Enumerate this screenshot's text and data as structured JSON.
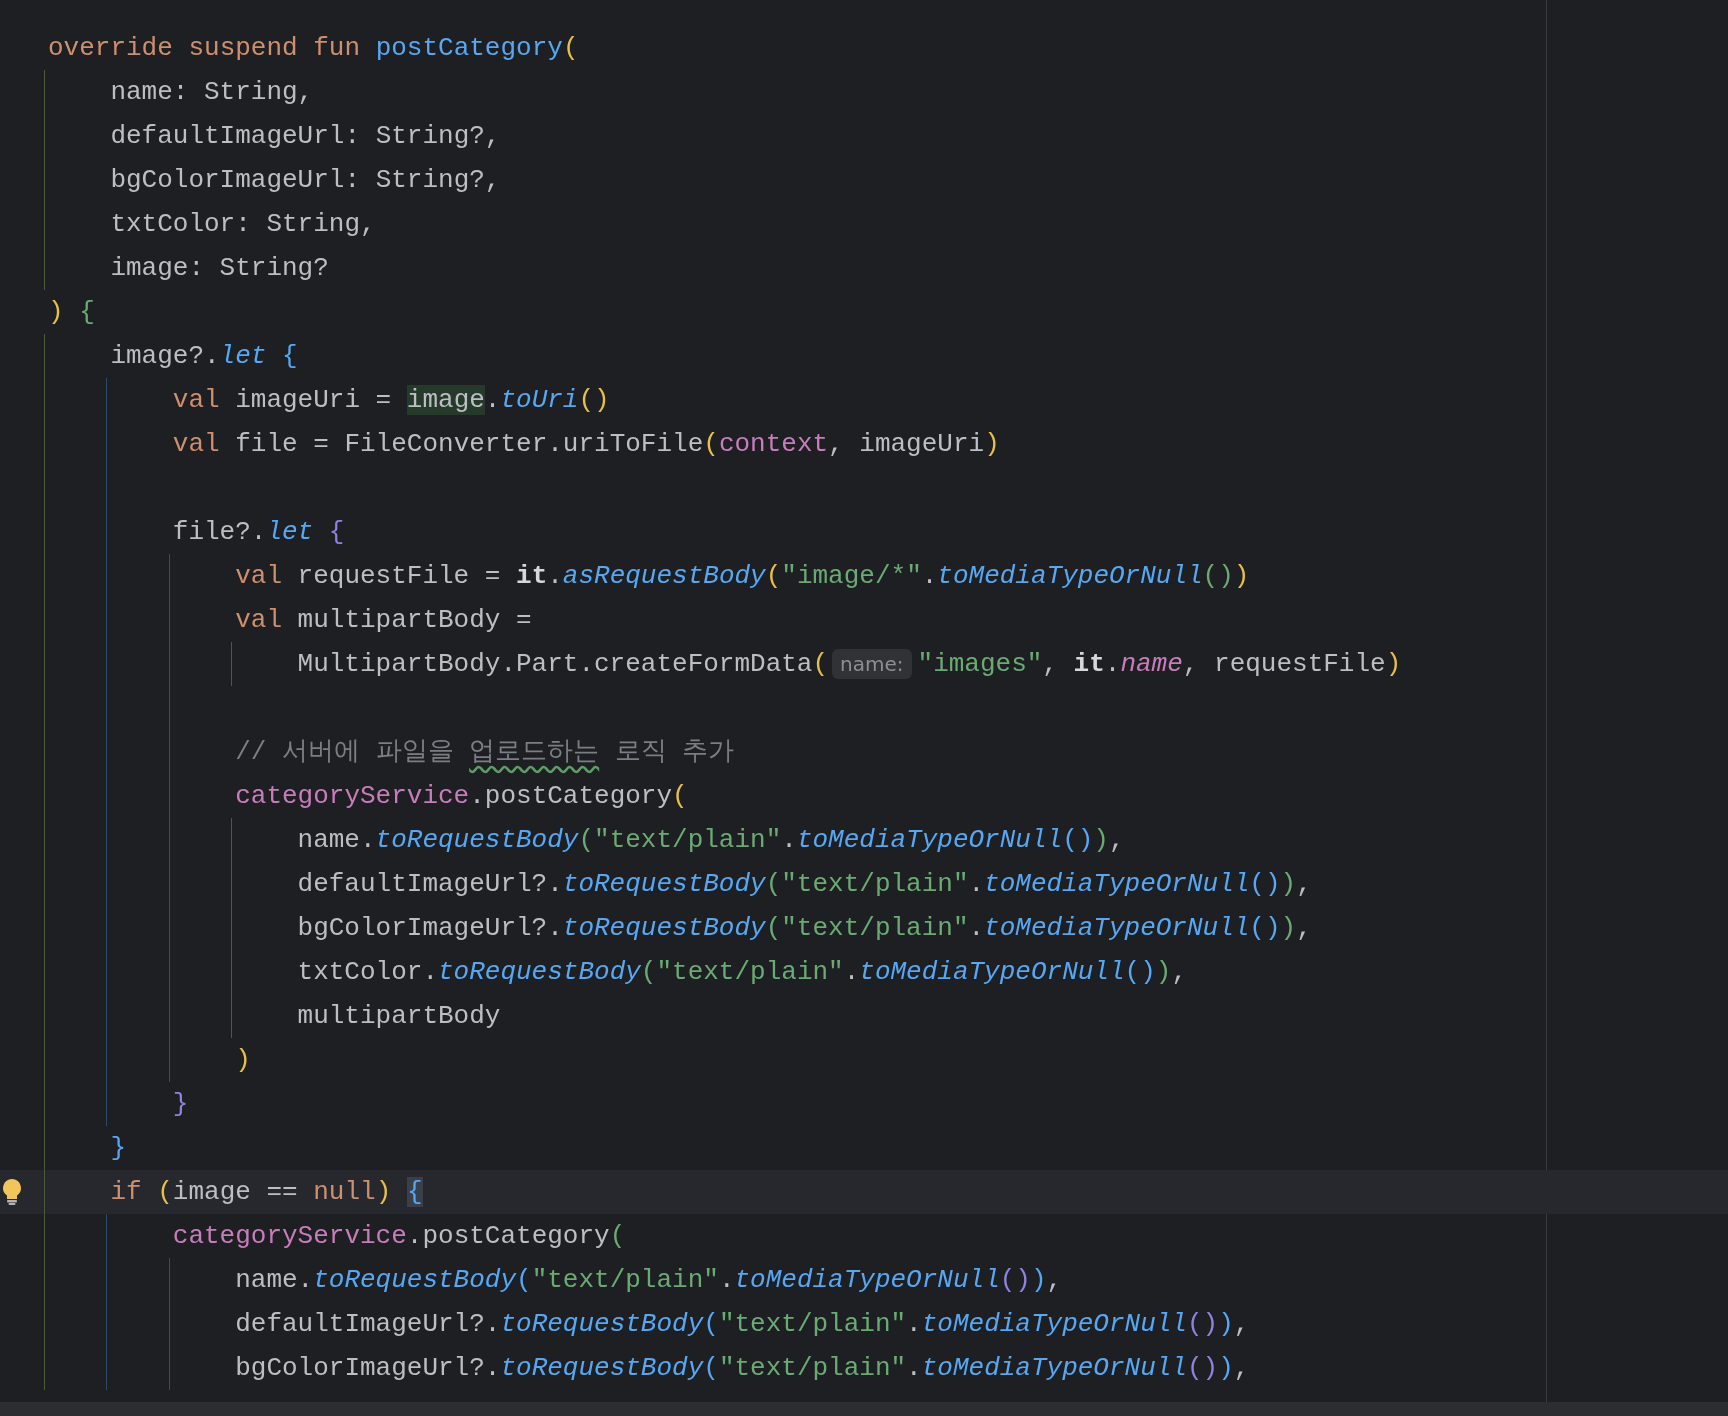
{
  "editor": {
    "lines": [
      {
        "current": false,
        "tokens": [
          {
            "kind": "kw",
            "text": "override suspend fun "
          },
          {
            "kind": "fn",
            "text": "postCategory"
          },
          {
            "kind": "b1",
            "text": "("
          }
        ]
      },
      {
        "current": false,
        "tokens": [
          {
            "kind": "id",
            "text": "    name: String,"
          }
        ]
      },
      {
        "current": false,
        "tokens": [
          {
            "kind": "id",
            "text": "    defaultImageUrl: String?,"
          }
        ]
      },
      {
        "current": false,
        "tokens": [
          {
            "kind": "id",
            "text": "    bgColorImageUrl: String?,"
          }
        ]
      },
      {
        "current": false,
        "tokens": [
          {
            "kind": "id",
            "text": "    txtColor: String,"
          }
        ]
      },
      {
        "current": false,
        "tokens": [
          {
            "kind": "id",
            "text": "    image: String?"
          }
        ]
      },
      {
        "current": false,
        "tokens": [
          {
            "kind": "b1",
            "text": ")"
          },
          {
            "kind": "b2",
            "text": " {"
          }
        ]
      },
      {
        "current": false,
        "tokens": [
          {
            "kind": "id",
            "text": "    image?."
          },
          {
            "kind": "ext",
            "text": "let"
          },
          {
            "kind": "b3",
            "text": " {"
          }
        ]
      },
      {
        "current": false,
        "tokens": [
          {
            "kind": "kw",
            "text": "        val"
          },
          {
            "kind": "id",
            "text": " imageUri = "
          },
          {
            "kind": "id-hl",
            "text": "image"
          },
          {
            "kind": "id",
            "text": "."
          },
          {
            "kind": "ext",
            "text": "toUri"
          },
          {
            "kind": "b1",
            "text": "()"
          }
        ]
      },
      {
        "current": false,
        "tokens": [
          {
            "kind": "kw",
            "text": "        val"
          },
          {
            "kind": "id",
            "text": " file = FileConverter.uriToFile"
          },
          {
            "kind": "b1",
            "text": "("
          },
          {
            "kind": "field",
            "text": "context"
          },
          {
            "kind": "id",
            "text": ", imageUri"
          },
          {
            "kind": "b1",
            "text": ")"
          }
        ]
      },
      {
        "current": false
      },
      {
        "current": false,
        "tokens": [
          {
            "kind": "id",
            "text": "        file?."
          },
          {
            "kind": "ext",
            "text": "let"
          },
          {
            "kind": "b4",
            "text": " {"
          }
        ]
      },
      {
        "current": false,
        "tokens": [
          {
            "kind": "kw",
            "text": "            val"
          },
          {
            "kind": "id",
            "text": " requestFile = "
          },
          {
            "kind": "bold",
            "text": "it"
          },
          {
            "kind": "id",
            "text": "."
          },
          {
            "kind": "ext",
            "text": "asRequestBody"
          },
          {
            "kind": "b1",
            "text": "("
          },
          {
            "kind": "str",
            "text": "\"image/*\""
          },
          {
            "kind": "id",
            "text": "."
          },
          {
            "kind": "ext",
            "text": "toMediaTypeOrNull"
          },
          {
            "kind": "b2",
            "text": "()"
          },
          {
            "kind": "b1",
            "text": ")"
          }
        ]
      },
      {
        "current": false,
        "tokens": [
          {
            "kind": "kw",
            "text": "            val"
          },
          {
            "kind": "id",
            "text": " multipartBody ="
          }
        ]
      },
      {
        "current": false,
        "tokens": [
          {
            "kind": "id",
            "text": "                MultipartBody.Part.createFormData"
          },
          {
            "kind": "b1",
            "text": "("
          },
          {
            "kind": "hint",
            "text": "name:"
          },
          {
            "kind": "str",
            "text": "\"images\""
          },
          {
            "kind": "id",
            "text": ", "
          },
          {
            "kind": "bold",
            "text": "it"
          },
          {
            "kind": "id",
            "text": "."
          },
          {
            "kind": "field-i",
            "text": "name"
          },
          {
            "kind": "id",
            "text": ", requestFile"
          },
          {
            "kind": "b1",
            "text": ")"
          }
        ]
      },
      {
        "current": false
      },
      {
        "current": false,
        "tokens": [
          {
            "kind": "comment",
            "text": "            // 서버에 파일을 "
          },
          {
            "kind": "typo",
            "text": "업로드하는"
          },
          {
            "kind": "comment",
            "text": " 로직 추가"
          }
        ]
      },
      {
        "current": false,
        "tokens": [
          {
            "kind": "field",
            "text": "            categoryService"
          },
          {
            "kind": "id",
            "text": ".postCategory"
          },
          {
            "kind": "b1",
            "text": "("
          }
        ]
      },
      {
        "current": false,
        "tokens": [
          {
            "kind": "id",
            "text": "                name."
          },
          {
            "kind": "ext",
            "text": "toRequestBody"
          },
          {
            "kind": "b2",
            "text": "("
          },
          {
            "kind": "str",
            "text": "\"text/plain\""
          },
          {
            "kind": "id",
            "text": "."
          },
          {
            "kind": "ext",
            "text": "toMediaTypeOrNull"
          },
          {
            "kind": "b3",
            "text": "()"
          },
          {
            "kind": "b2",
            "text": ")"
          },
          {
            "kind": "id",
            "text": ","
          }
        ]
      },
      {
        "current": false,
        "tokens": [
          {
            "kind": "id",
            "text": "                defaultImageUrl?."
          },
          {
            "kind": "ext",
            "text": "toRequestBody"
          },
          {
            "kind": "b2",
            "text": "("
          },
          {
            "kind": "str",
            "text": "\"text/plain\""
          },
          {
            "kind": "id",
            "text": "."
          },
          {
            "kind": "ext",
            "text": "toMediaTypeOrNull"
          },
          {
            "kind": "b3",
            "text": "()"
          },
          {
            "kind": "b2",
            "text": ")"
          },
          {
            "kind": "id",
            "text": ","
          }
        ]
      },
      {
        "current": false,
        "tokens": [
          {
            "kind": "id",
            "text": "                bgColorImageUrl?."
          },
          {
            "kind": "ext",
            "text": "toRequestBody"
          },
          {
            "kind": "b2",
            "text": "("
          },
          {
            "kind": "str",
            "text": "\"text/plain\""
          },
          {
            "kind": "id",
            "text": "."
          },
          {
            "kind": "ext",
            "text": "toMediaTypeOrNull"
          },
          {
            "kind": "b3",
            "text": "()"
          },
          {
            "kind": "b2",
            "text": ")"
          },
          {
            "kind": "id",
            "text": ","
          }
        ]
      },
      {
        "current": false,
        "tokens": [
          {
            "kind": "id",
            "text": "                txtColor."
          },
          {
            "kind": "ext",
            "text": "toRequestBody"
          },
          {
            "kind": "b2",
            "text": "("
          },
          {
            "kind": "str",
            "text": "\"text/plain\""
          },
          {
            "kind": "id",
            "text": "."
          },
          {
            "kind": "ext",
            "text": "toMediaTypeOrNull"
          },
          {
            "kind": "b3",
            "text": "()"
          },
          {
            "kind": "b2",
            "text": ")"
          },
          {
            "kind": "id",
            "text": ","
          }
        ]
      },
      {
        "current": false,
        "tokens": [
          {
            "kind": "id",
            "text": "                multipartBody"
          }
        ]
      },
      {
        "current": false,
        "tokens": [
          {
            "kind": "b1",
            "text": "            )"
          }
        ]
      },
      {
        "current": false,
        "tokens": [
          {
            "kind": "b4",
            "text": "        }"
          }
        ]
      },
      {
        "current": false,
        "tokens": [
          {
            "kind": "b3",
            "text": "    }"
          }
        ]
      },
      {
        "current": true,
        "tokens": [
          {
            "kind": "kw",
            "text": "    if"
          },
          {
            "kind": "b1",
            "text": " ("
          },
          {
            "kind": "id",
            "text": "image == "
          },
          {
            "kind": "kw",
            "text": "null"
          },
          {
            "kind": "b1",
            "text": ") "
          },
          {
            "kind": "b3-hl",
            "text": "{"
          }
        ]
      },
      {
        "current": false,
        "tokens": [
          {
            "kind": "field",
            "text": "        categoryService"
          },
          {
            "kind": "id",
            "text": ".postCategory"
          },
          {
            "kind": "b2",
            "text": "("
          }
        ]
      },
      {
        "current": false,
        "tokens": [
          {
            "kind": "id",
            "text": "            name."
          },
          {
            "kind": "ext",
            "text": "toRequestBody"
          },
          {
            "kind": "b3",
            "text": "("
          },
          {
            "kind": "str",
            "text": "\"text/plain\""
          },
          {
            "kind": "id",
            "text": "."
          },
          {
            "kind": "ext",
            "text": "toMediaTypeOrNull"
          },
          {
            "kind": "b4",
            "text": "()"
          },
          {
            "kind": "b3",
            "text": ")"
          },
          {
            "kind": "id",
            "text": ","
          }
        ]
      },
      {
        "current": false,
        "tokens": [
          {
            "kind": "id",
            "text": "            defaultImageUrl?."
          },
          {
            "kind": "ext",
            "text": "toRequestBody"
          },
          {
            "kind": "b3",
            "text": "("
          },
          {
            "kind": "str",
            "text": "\"text/plain\""
          },
          {
            "kind": "id",
            "text": "."
          },
          {
            "kind": "ext",
            "text": "toMediaTypeOrNull"
          },
          {
            "kind": "b4",
            "text": "()"
          },
          {
            "kind": "b3",
            "text": ")"
          },
          {
            "kind": "id",
            "text": ","
          }
        ]
      },
      {
        "current": false,
        "tokens": [
          {
            "kind": "id",
            "text": "            bgColorImageUrl?."
          },
          {
            "kind": "ext",
            "text": "toRequestBody"
          },
          {
            "kind": "b3",
            "text": "("
          },
          {
            "kind": "str",
            "text": "\"text/plain\""
          },
          {
            "kind": "id",
            "text": "."
          },
          {
            "kind": "ext",
            "text": "toMediaTypeOrNull"
          },
          {
            "kind": "b4",
            "text": "()"
          },
          {
            "kind": "b3",
            "text": ")"
          },
          {
            "kind": "id",
            "text": ","
          }
        ]
      }
    ]
  }
}
